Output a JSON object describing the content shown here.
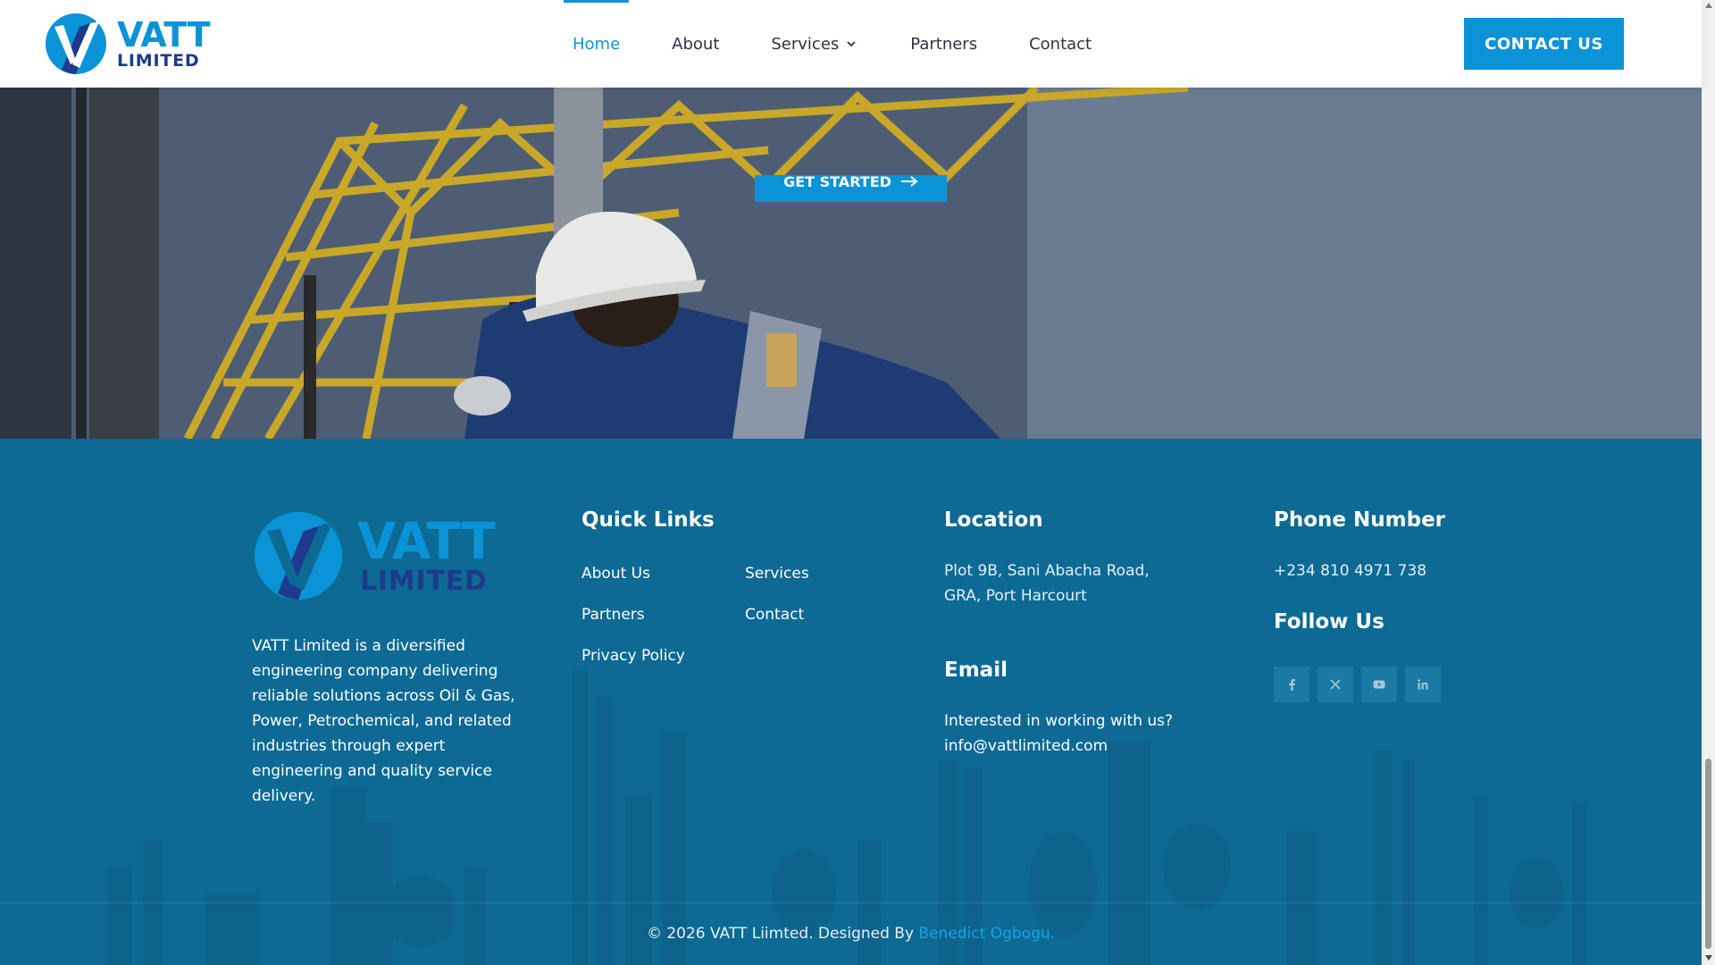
{
  "brand": {
    "name": "VATT",
    "suffix": "LIMITED",
    "colors": {
      "light_blue": "#0b93d8",
      "dark_blue": "#1d3a8e",
      "footer_bg": "#0c6a94",
      "accent": "#1aa3e6"
    }
  },
  "nav": {
    "items": [
      {
        "label": "Home",
        "active": true
      },
      {
        "label": "About"
      },
      {
        "label": "Services",
        "has_dropdown": true,
        "icon": "chevron-down-icon"
      },
      {
        "label": "Partners"
      },
      {
        "label": "Contact"
      }
    ],
    "cta_label": "CONTACT US"
  },
  "hero": {
    "button_label": "GET STARTED",
    "button_icon": "arrow-right-icon"
  },
  "footer": {
    "about_text": "VATT Limited is a diversified engineering company delivering reliable solutions across Oil & Gas, Power, Petrochemical, and related industries through expert engineering and quality service delivery.",
    "quick_links": {
      "heading": "Quick Links",
      "items": [
        "About Us",
        "Services",
        "Partners",
        "Contact",
        "Privacy Policy"
      ]
    },
    "location": {
      "heading": "Location",
      "line1": "Plot 9B, Sani Abacha Road,",
      "line2": "GRA, Port Harcourt"
    },
    "email": {
      "heading": "Email",
      "prompt": "Interested in working with us?",
      "address": "info@vattlimited.com"
    },
    "phone": {
      "heading": "Phone Number",
      "number": "+234 810 4971 738"
    },
    "follow": {
      "heading": "Follow Us",
      "icons": [
        "facebook-icon",
        "x-icon",
        "youtube-icon",
        "linkedin-icon"
      ]
    },
    "copyright": "© 2026 VATT Liimted. Designed By",
    "designer": "Benedict Ogbogu."
  }
}
